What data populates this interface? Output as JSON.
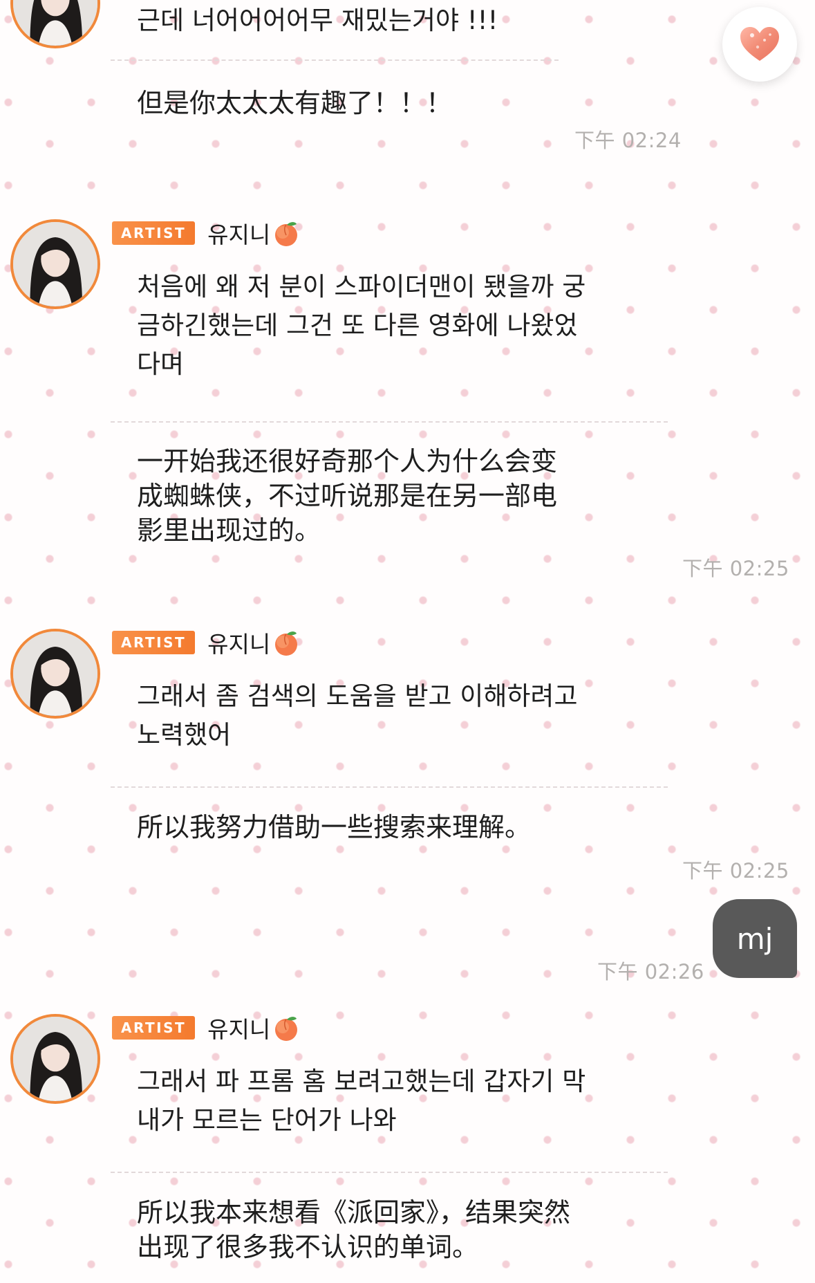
{
  "badge_label": "ARTIST",
  "sender_name": "유지니",
  "my_reply": "mj",
  "groups": [
    {
      "ko": "근데 너어어어어무 재밌는거야 !!!",
      "zh": "但是你太太太有趣了！！！",
      "time": "下午 02:24"
    },
    {
      "ko": "처음에 왜 저 분이 스파이더맨이 됐을까 궁\n금하긴했는데 그건 또 다른 영화에 나왔었\n다며",
      "zh": "一开始我还很好奇那个人为什么会变\n成蜘蛛侠，不过听说那是在另一部电\n影里出现过的。",
      "time": "下午 02:25"
    },
    {
      "ko": "그래서 좀 검색의 도움을 받고 이해하려고\n노력했어",
      "zh": "所以我努力借助一些搜索来理解。",
      "time": "下午 02:25"
    },
    {
      "ko": "그래서 파 프롬 홈 보려고했는데 갑자기 막\n내가 모르는 단어가 나와",
      "zh": "所以我本来想看《派回家》，结果突然\n出现了很多我不认识的单词。"
    }
  ],
  "my_time": "下午 02:26",
  "colors": {
    "badge": "#f47a2e",
    "avatar_ring": "#f1893b",
    "bubble": "#595959",
    "time": "#b3b0ae",
    "pattern": "#f4cfd6"
  },
  "icons": {
    "heart": "heart-icon",
    "peach": "peach-icon"
  }
}
